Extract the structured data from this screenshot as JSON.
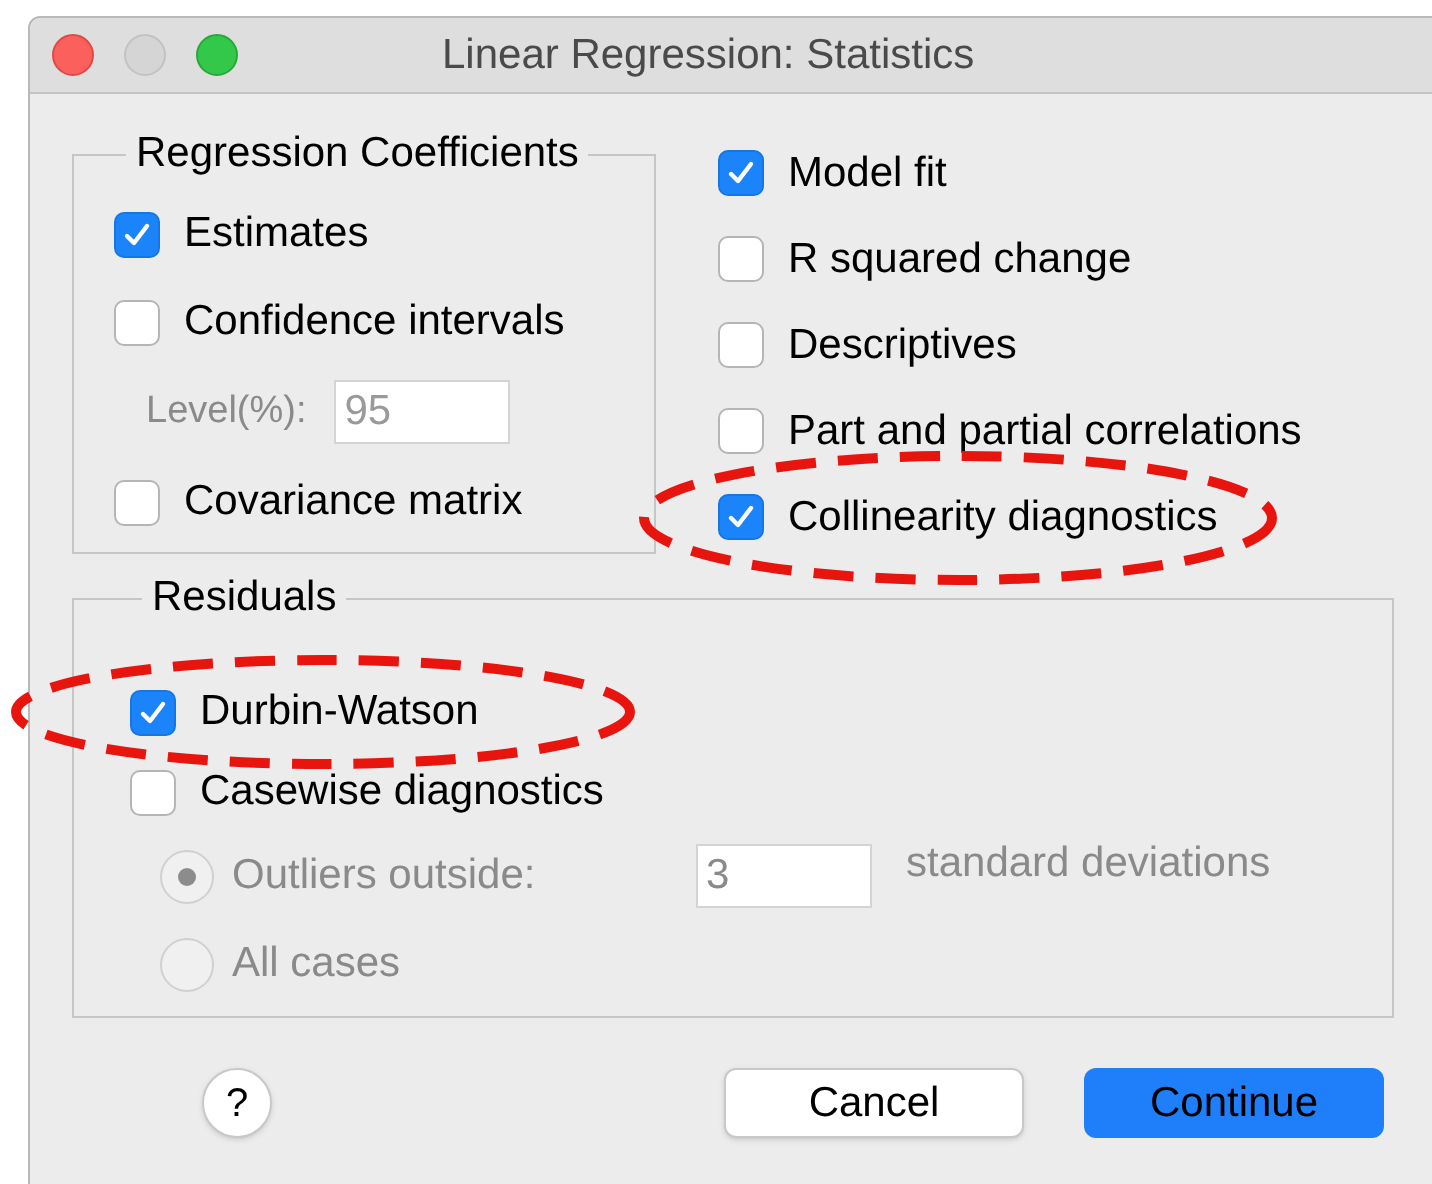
{
  "window": {
    "title": "Linear Regression: Statistics"
  },
  "regression_coefficients": {
    "title": "Regression Coefficients",
    "items": [
      {
        "kind": "checkbox",
        "label": "Estimates",
        "checked": true,
        "highlighted": false
      },
      {
        "kind": "checkbox",
        "label": "Confidence intervals",
        "checked": false,
        "highlighted": false
      },
      {
        "kind": "field",
        "label": "Level(%):",
        "value": "95",
        "disabled": true
      },
      {
        "kind": "checkbox",
        "label": "Covariance matrix",
        "checked": false,
        "highlighted": false
      }
    ]
  },
  "options": [
    {
      "label": "Model fit",
      "checked": true,
      "highlighted": false
    },
    {
      "label": "R squared change",
      "checked": false,
      "highlighted": false
    },
    {
      "label": "Descriptives",
      "checked": false,
      "highlighted": false
    },
    {
      "label": "Part and partial correlations",
      "checked": false,
      "highlighted": false
    },
    {
      "label": "Collinearity diagnostics",
      "checked": true,
      "highlighted": true
    }
  ],
  "residuals": {
    "title": "Residuals",
    "items": [
      {
        "kind": "checkbox",
        "label": "Durbin-Watson",
        "checked": true,
        "highlighted": true
      },
      {
        "kind": "checkbox",
        "label": "Casewise diagnostics",
        "checked": false,
        "highlighted": false
      },
      {
        "kind": "radio",
        "label": "Outliers outside:",
        "selected": true,
        "disabled": true,
        "value": "3",
        "unit": "standard deviations"
      },
      {
        "kind": "radio",
        "label": "All cases",
        "selected": false,
        "disabled": true
      }
    ]
  },
  "buttons": [
    {
      "kind": "help",
      "label": "?"
    },
    {
      "kind": "cancel",
      "label": "Cancel",
      "default": false
    },
    {
      "kind": "continue",
      "label": "Continue",
      "default": true
    }
  ]
}
